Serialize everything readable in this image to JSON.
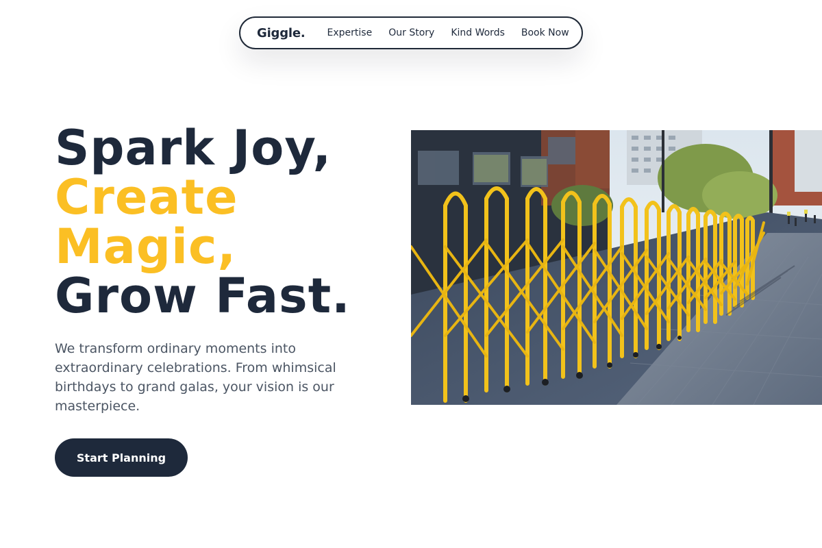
{
  "nav": {
    "logo": "Giggle.",
    "links": [
      "Expertise",
      "Our Story",
      "Kind Words",
      "Book Now"
    ]
  },
  "hero": {
    "headline": {
      "line1": "Spark Joy,",
      "line2": "Create",
      "line3": "Magic,",
      "line4": "Grow Fast."
    },
    "subtext": "We transform ordinary moments into extraordinary celebrations. From whimsical birthdays to grand galas, your vision is our masterpiece.",
    "cta_label": "Start Planning",
    "image": {
      "subject": "yellow folding barrier fence along a city sidewalk"
    }
  },
  "colors": {
    "primary": "#1e293b",
    "accent": "#fbbf24",
    "body_text": "#4b5563",
    "background": "#ffffff"
  }
}
